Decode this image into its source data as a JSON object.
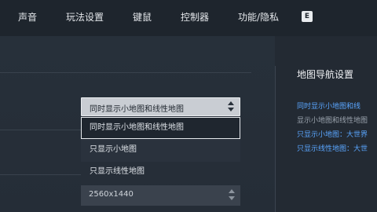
{
  "tabs": [
    {
      "label": "声音"
    },
    {
      "label": "玩法设置"
    },
    {
      "label": "键鼠"
    },
    {
      "label": "控制器"
    },
    {
      "label": "功能/隐私"
    }
  ],
  "hotkey_badge": "E",
  "minimap_select": {
    "value": "同时显示小地图和线性地图",
    "options": [
      "同时显示小地图和线性地图",
      "只显示小地图",
      "只显示线性地图"
    ]
  },
  "resolution_select": {
    "value": "2560x1440"
  },
  "help_panel": {
    "title": "地图导航设置",
    "lines": [
      {
        "text": "同时显示小地图和线",
        "style": "hl"
      },
      {
        "text": "显示小地图和线性地图",
        "style": "dim"
      },
      {
        "text": "只显示小地图：大世界",
        "style": "hl"
      },
      {
        "text": "只显示线性地图：大世",
        "style": "hl"
      }
    ]
  }
}
